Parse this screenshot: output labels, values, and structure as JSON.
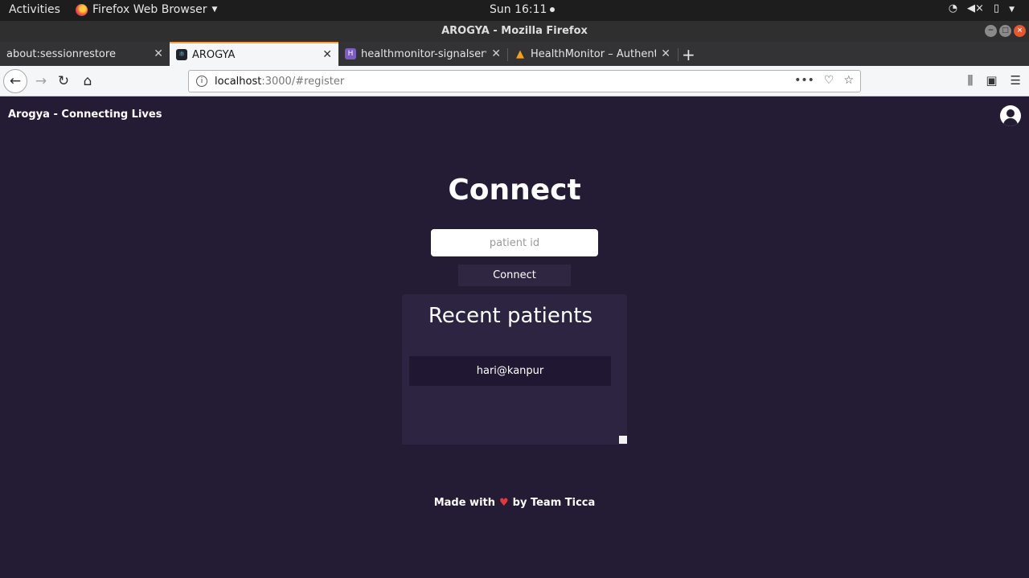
{
  "os_bar": {
    "activities": "Activities",
    "app_name": "Firefox Web Browser",
    "clock": "Sun 16:11"
  },
  "window": {
    "title": "AROGYA - Mozilla Firefox"
  },
  "tabs": [
    {
      "label": "about:sessionrestore",
      "active": false
    },
    {
      "label": "AROGYA",
      "active": true
    },
    {
      "label": "healthmonitor-signalserver",
      "active": false
    },
    {
      "label": "HealthMonitor – Authentication",
      "active": false
    }
  ],
  "urlbar": {
    "host": "localhost",
    "path": ":3000/#register"
  },
  "page": {
    "brand": "Arogya - Connecting Lives",
    "heading": "Connect",
    "patient_id_placeholder": "patient id",
    "connect_button": "Connect",
    "recent_title": "Recent patients",
    "recent_patients": [
      "hari@kanpur"
    ],
    "footer_prefix": "Made with",
    "footer_suffix": "by Team Ticca"
  },
  "colors": {
    "page_background": "#241b35",
    "card_background": "#2c2440",
    "active_tab_accent": "#ff9b39",
    "heart": "#e5383b"
  }
}
